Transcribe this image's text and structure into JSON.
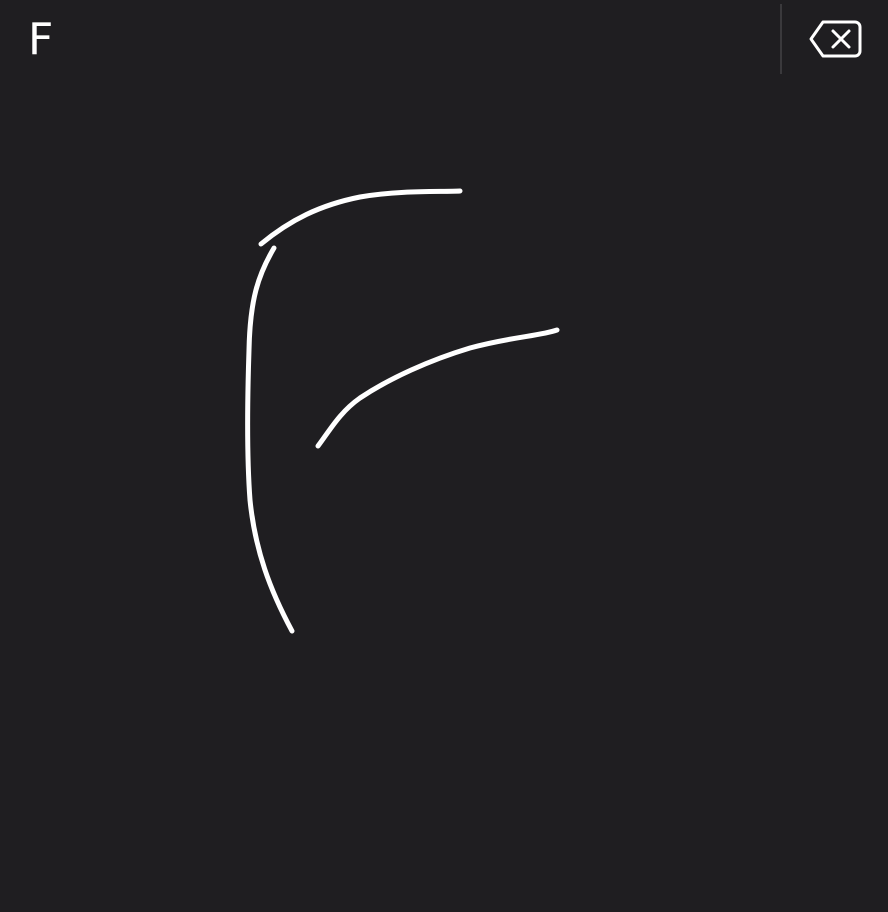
{
  "candidate_bar": {
    "candidates": [
      "F"
    ]
  },
  "toolbar": {
    "delete_icon": "backspace-icon"
  },
  "colors": {
    "background": "#1f1e21",
    "ink": "#ffffff",
    "divider": "#3a393c"
  }
}
